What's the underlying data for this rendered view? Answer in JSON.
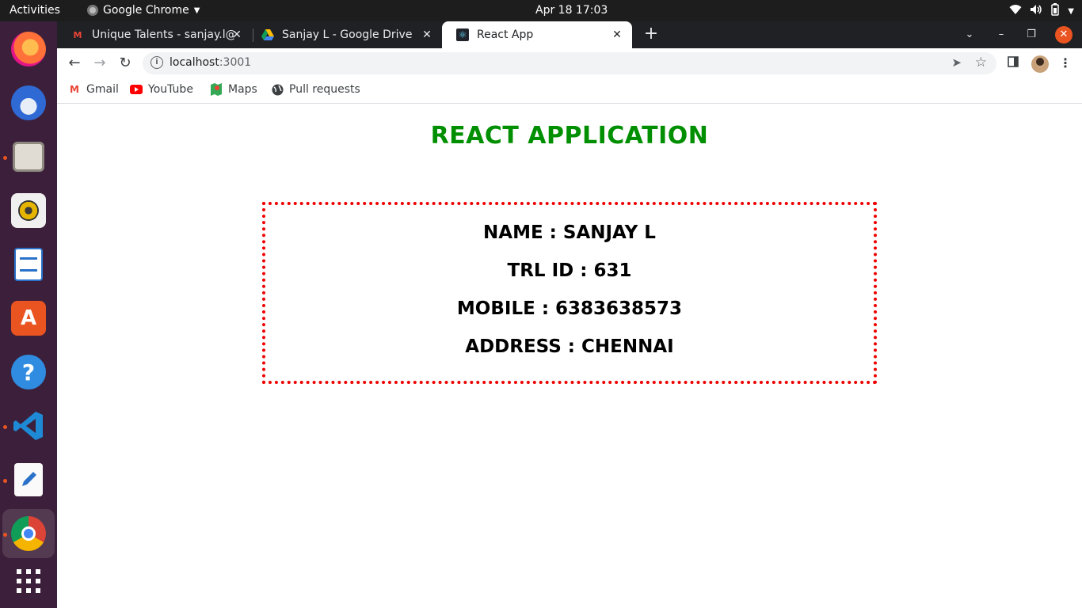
{
  "topbar": {
    "activities": "Activities",
    "app_name": "Google Chrome",
    "clock": "Apr 18  17:03"
  },
  "tabs": [
    {
      "title": "Unique Talents - sanjay.l@",
      "favicon": "gmail-icon",
      "active": false
    },
    {
      "title": "Sanjay L - Google Drive",
      "favicon": "google-drive-icon",
      "active": false
    },
    {
      "title": "React App",
      "favicon": "react-icon",
      "active": true
    }
  ],
  "address_bar": {
    "host": "localhost",
    "port": ":3001"
  },
  "bookmarks": [
    {
      "label": "Gmail",
      "icon": "gmail-icon"
    },
    {
      "label": "YouTube",
      "icon": "youtube-icon"
    },
    {
      "label": "Maps",
      "icon": "maps-icon"
    },
    {
      "label": "Pull requests",
      "icon": "github-icon"
    }
  ],
  "dock": [
    {
      "name": "firefox",
      "running": false
    },
    {
      "name": "thunderbird",
      "running": false
    },
    {
      "name": "files",
      "running": true
    },
    {
      "name": "rhythmbox",
      "running": false
    },
    {
      "name": "libreoffice-writer",
      "running": false
    },
    {
      "name": "ubuntu-software",
      "running": false
    },
    {
      "name": "help",
      "running": false
    },
    {
      "name": "vscode",
      "running": true
    },
    {
      "name": "text-editor",
      "running": true
    },
    {
      "name": "chrome",
      "running": true
    }
  ],
  "app": {
    "title": "REACT APPLICATION",
    "name_line": "NAME : SANJAY L",
    "id_line": "TRL ID : 631",
    "mobile_line": "MOBILE : 6383638573",
    "address_line": "ADDRESS : CHENNAI"
  },
  "colors": {
    "title_green": "#008f00",
    "border_red": "#ee0000",
    "dock_bg": "#3c1f3a",
    "tabstrip_bg": "#202124",
    "close_orange": "#e95420"
  }
}
